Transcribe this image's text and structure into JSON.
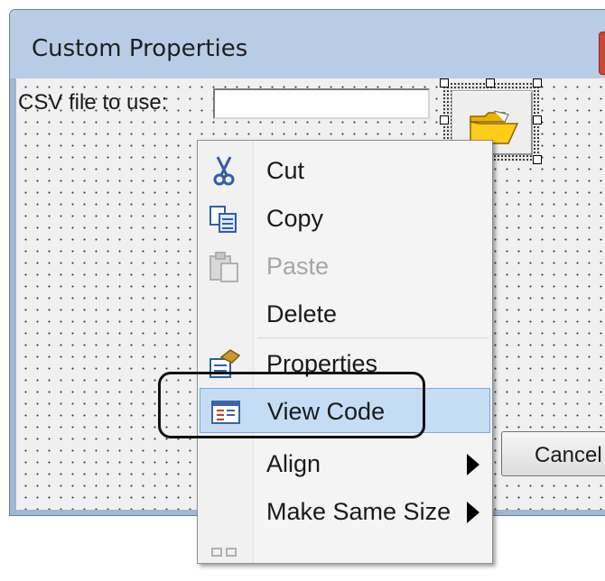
{
  "window": {
    "title": "Custom Properties"
  },
  "form": {
    "csv_label": "CSV file to use:",
    "csv_value": "",
    "cancel_label": "Cancel",
    "folder_icon": "open-folder-icon"
  },
  "context_menu": {
    "items": [
      {
        "label": "Cut",
        "icon": "scissors-icon",
        "disabled": false
      },
      {
        "label": "Copy",
        "icon": "copy-icon",
        "disabled": false
      },
      {
        "label": "Paste",
        "icon": "paste-icon",
        "disabled": true
      },
      {
        "label": "Delete",
        "icon": "",
        "disabled": false
      },
      {
        "label": "Properties",
        "icon": "properties-icon",
        "disabled": false
      },
      {
        "label": "View Code",
        "icon": "view-code-icon",
        "disabled": false,
        "highlighted": true
      },
      {
        "label": "Align",
        "icon": "",
        "disabled": false,
        "submenu": true
      },
      {
        "label": "Make Same Size",
        "icon": "",
        "disabled": false,
        "submenu": true
      }
    ]
  },
  "colors": {
    "highlight": "#c4ddf5",
    "highlight_border": "#7aa9d8",
    "disabled_text": "#a6a6a6",
    "titlebar": "#b8cde5"
  }
}
